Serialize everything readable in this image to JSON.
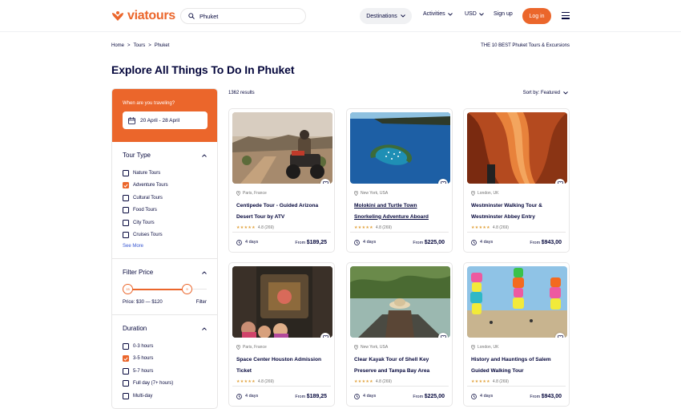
{
  "brand": {
    "name": "viatours",
    "accent": "#EB662B",
    "text": "#05073C"
  },
  "header": {
    "search_value": "Phuket",
    "destinations": "Destinations",
    "activities": "Activities",
    "currency": "USD",
    "signup": "Sign up",
    "login": "Log in"
  },
  "breadcrumb": [
    "Home",
    "Tours",
    "Phuket"
  ],
  "top_best": "THE 10 BEST Phuket Tours & Excursions",
  "page_title": "Explore All Things To Do In Phuket",
  "sidebar": {
    "when_label": "When are you traveling?",
    "date_range": "20 April - 28 April",
    "tour_type": {
      "title": "Tour Type",
      "items": [
        {
          "label": "Nature Tours",
          "checked": false
        },
        {
          "label": "Adventure Tours",
          "checked": true
        },
        {
          "label": "Cultural Tours",
          "checked": false
        },
        {
          "label": "Food Tours",
          "checked": false
        },
        {
          "label": "City Tours",
          "checked": false
        },
        {
          "label": "Cruises Tours",
          "checked": false
        }
      ],
      "see_more": "See More"
    },
    "filter_price": {
      "title": "Filter Price",
      "min_knob": "15",
      "max_knob": "9",
      "range_text": "Price: $30 — $120",
      "filter_label": "Filter"
    },
    "duration": {
      "title": "Duration",
      "items": [
        {
          "label": "0-3 hours",
          "checked": false
        },
        {
          "label": "3-5 hours",
          "checked": true
        },
        {
          "label": "5-7 hours",
          "checked": false
        },
        {
          "label": "Full day (7+ hours)",
          "checked": false
        },
        {
          "label": "Multi-day",
          "checked": false
        }
      ]
    }
  },
  "results": {
    "count": "1362 results",
    "sort": "Sort by: Featured"
  },
  "cards": [
    {
      "location": "Paris, France",
      "title": "Centipede Tour - Guided Arizona Desert Tour by ATV",
      "rating": "4.8 (269)",
      "days": "4 days",
      "price_prefix": "From",
      "price": "$189,25",
      "image": "atv-desert-photo"
    },
    {
      "location": "New York, USA",
      "title": "Molokini and Turtle Town Snorkeling Adventure Aboard",
      "rating": "4.8 (269)",
      "days": "4 days",
      "price_prefix": "From",
      "price": "$225,00",
      "image": "molokini-island-photo"
    },
    {
      "location": "London, UK",
      "title": "Westminster Walking Tour & Westminster Abbey Entry",
      "rating": "4.8 (269)",
      "days": "4 days",
      "price_prefix": "From",
      "price": "$943,00",
      "image": "antelope-canyon-photo"
    },
    {
      "location": "Paris, France",
      "title": "Space Center Houston Admission Ticket",
      "rating": "4.8 (269)",
      "days": "4 days",
      "price_prefix": "From",
      "price": "$189,25",
      "image": "space-center-photo"
    },
    {
      "location": "New York, USA",
      "title": "Clear Kayak Tour of Shell Key Preserve and Tampa Bay Area",
      "rating": "4.8 (269)",
      "days": "4 days",
      "price_prefix": "From",
      "price": "$225,00",
      "image": "kayak-photo"
    },
    {
      "location": "London, UK",
      "title": "History and Hauntings of Salem Guided Walking Tour",
      "rating": "4.8 (269)",
      "days": "4 days",
      "price_prefix": "From",
      "price": "$943,00",
      "image": "seven-magic-mountains-photo"
    }
  ]
}
